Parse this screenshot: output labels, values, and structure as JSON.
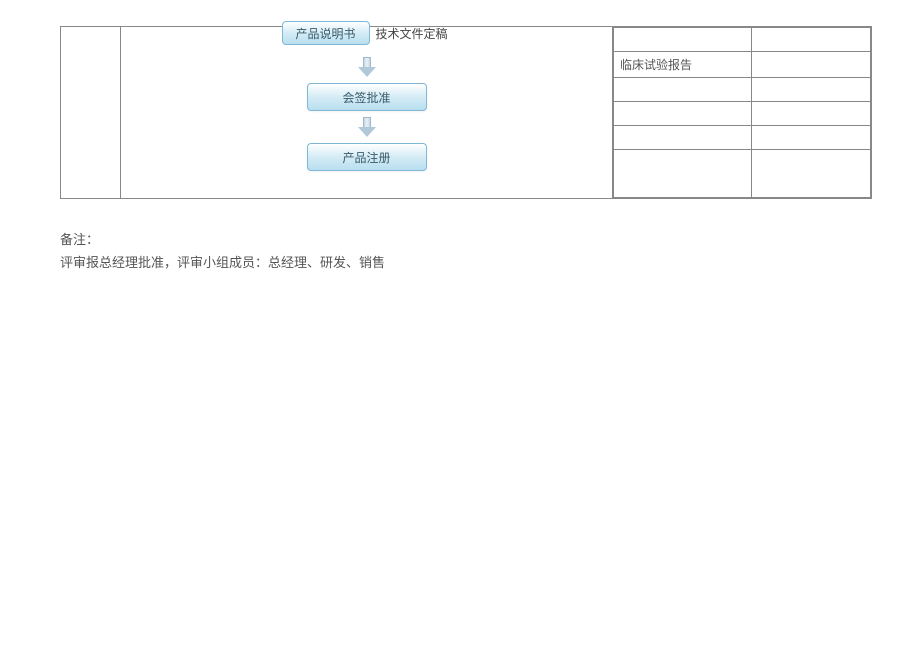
{
  "flow": {
    "box1_inner": "产品说明书",
    "box1_side": "技术文件定稿",
    "box2": "会签批准",
    "box3": "产品注册"
  },
  "right_rows": {
    "r1": "",
    "r2": "临床试验报告",
    "r3": "",
    "r4": "",
    "r5": "",
    "r6": ""
  },
  "notes": {
    "line1": "备注：",
    "line2": "评审报总经理批准，评审小组成员：总经理、研发、销售"
  }
}
